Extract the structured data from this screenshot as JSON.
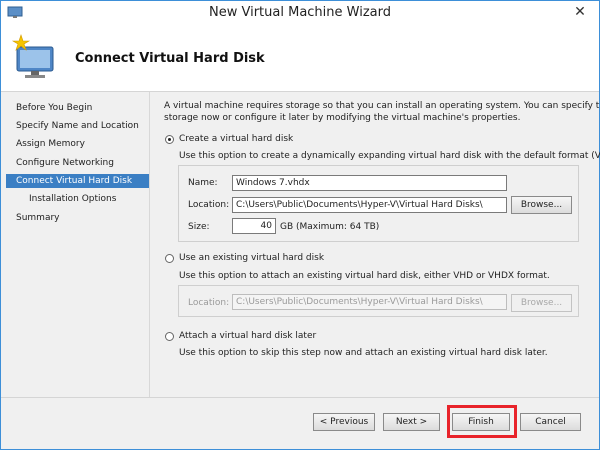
{
  "window": {
    "title": "New Virtual Machine Wizard",
    "close_glyph": "✕"
  },
  "header": {
    "title": "Connect Virtual Hard Disk"
  },
  "nav": {
    "items": [
      {
        "label": "Before You Begin"
      },
      {
        "label": "Specify Name and Location"
      },
      {
        "label": "Assign Memory"
      },
      {
        "label": "Configure Networking"
      },
      {
        "label": "Connect Virtual Hard Disk"
      },
      {
        "label": "Installation Options"
      },
      {
        "label": "Summary"
      }
    ]
  },
  "content": {
    "intro_line1": "A virtual machine requires storage so that you can install an operating system. You can specify the",
    "intro_line2": "storage now or configure it later by modifying the virtual machine's properties.",
    "create": {
      "label": "Create a virtual hard disk",
      "description": "Use this option to create a dynamically expanding virtual hard disk with the default format (VHDX).",
      "name_label": "Name:",
      "name_value": "Windows 7.vhdx",
      "location_label": "Location:",
      "location_value": "C:\\Users\\Public\\Documents\\Hyper-V\\Virtual Hard Disks\\",
      "browse_label": "Browse...",
      "size_label": "Size:",
      "size_value": "40",
      "size_unit": "GB (Maximum: 64 TB)"
    },
    "existing": {
      "label": "Use an existing virtual hard disk",
      "description": "Use this option to attach an existing virtual hard disk, either VHD or VHDX format.",
      "location_label": "Location:",
      "location_value": "C:\\Users\\Public\\Documents\\Hyper-V\\Virtual Hard Disks\\",
      "browse_label": "Browse..."
    },
    "later": {
      "label": "Attach a virtual hard disk later",
      "description": "Use this option to skip this step now and attach an existing virtual hard disk later."
    }
  },
  "footer": {
    "previous_label": "< Previous",
    "next_label": "Next >",
    "finish_label": "Finish",
    "cancel_label": "Cancel"
  },
  "colors": {
    "accent": "#3b7fc4",
    "highlight": "#e8232a"
  }
}
